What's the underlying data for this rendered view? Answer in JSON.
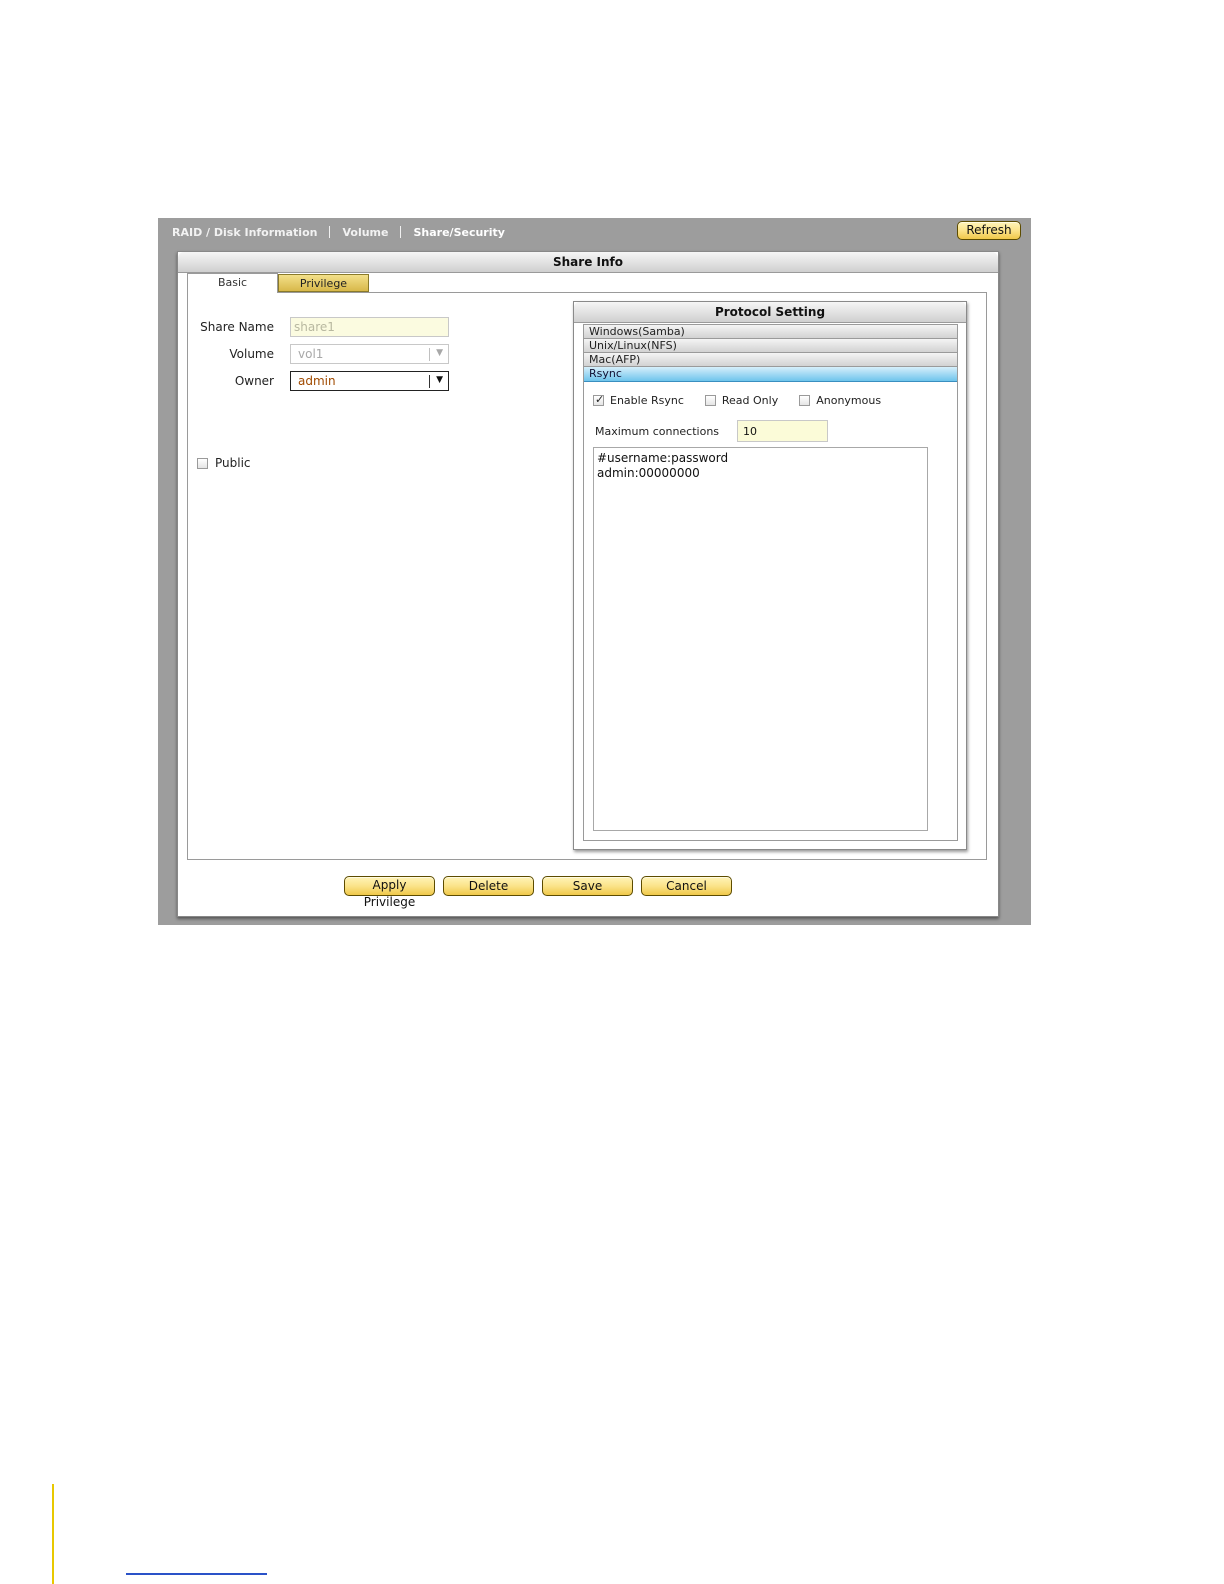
{
  "nav": {
    "items": [
      {
        "label": "RAID / Disk Information"
      },
      {
        "label": "Volume"
      },
      {
        "label": "Share/Security"
      }
    ],
    "refresh_label": "Refresh"
  },
  "share_info": {
    "title": "Share Info",
    "tabs": [
      {
        "label": "Basic",
        "active": true
      },
      {
        "label": "Privilege",
        "active": false
      }
    ],
    "basic": {
      "share_name": {
        "label": "Share Name",
        "value": "share1"
      },
      "volume": {
        "label": "Volume",
        "value": "vol1"
      },
      "owner": {
        "label": "Owner",
        "value": "admin"
      },
      "public": {
        "label": "Public",
        "checked": false
      }
    },
    "protocol": {
      "title": "Protocol Setting",
      "sections": [
        {
          "label": "Windows(Samba)"
        },
        {
          "label": "Unix/Linux(NFS)"
        },
        {
          "label": "Mac(AFP)"
        },
        {
          "label": "Rsync",
          "active": true
        }
      ],
      "rsync": {
        "enable": {
          "label": "Enable Rsync",
          "checked": true
        },
        "read_only": {
          "label": "Read Only",
          "checked": false
        },
        "anonymous": {
          "label": "Anonymous",
          "checked": false
        },
        "max_connections": {
          "label": "Maximum connections",
          "value": "10"
        },
        "accounts": {
          "line1": "#username:password",
          "line2": "admin:00000000"
        }
      }
    },
    "actions": {
      "apply_privilege": "Apply Privilege",
      "delete": "Delete",
      "save": "Save",
      "cancel": "Cancel"
    }
  }
}
